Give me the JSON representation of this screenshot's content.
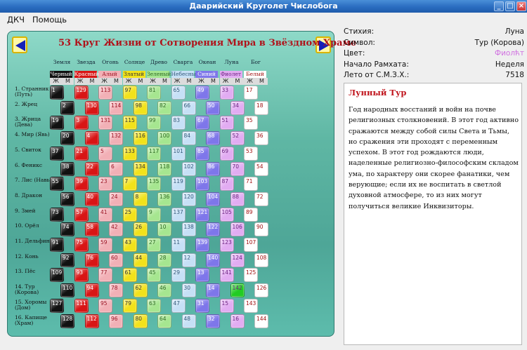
{
  "window": {
    "title": "Даарийский Круголет Числобога"
  },
  "menu": {
    "items": [
      "ДКЧ",
      "Помощь"
    ]
  },
  "board": {
    "header": "53  Круг Жизни от Сотворения Мира в Звёздном Храме",
    "elements": [
      "Земля",
      "Звезда",
      "Огонь",
      "Солнце",
      "Древо",
      "Сварга",
      "Океан",
      "Луна",
      "Бог"
    ],
    "colors": [
      {
        "name": "Черный",
        "hex": "#111111",
        "text": "#ffffff"
      },
      {
        "name": "Красный",
        "hex": "#d81515",
        "text": "#ffffff"
      },
      {
        "name": "Алый",
        "hex": "#f2b0b6",
        "text": "#9b1020"
      },
      {
        "name": "Златый",
        "hex": "#f2e21a",
        "text": "#333333"
      },
      {
        "name": "Зеленый",
        "hex": "#a6e690",
        "text": "#2d6b22"
      },
      {
        "name": "Небесный",
        "hex": "#c6e0f6",
        "text": "#345a7a"
      },
      {
        "name": "Синий",
        "hex": "#7e76ea",
        "text": "#ffffff"
      },
      {
        "name": "Фиолет",
        "hex": "#e2acf2",
        "text": "#6a1f7e"
      },
      {
        "name": "Белый",
        "hex": "#ffffff",
        "text": "#a01010"
      }
    ],
    "gm": [
      "Ж",
      "М"
    ],
    "rows": [
      "1. Странник (Путь)",
      "2. Жрец",
      "3. Жрица (Дева)",
      "4. Мир (Явь)",
      "5. Свиток",
      "6. Феникс",
      "7. Лис (Навь)",
      "8. Дракон",
      "9. Змей",
      "10. Орёл",
      "11. Дельфин",
      "12. Конь",
      "13. Пёс",
      "14. Тур (Корова)",
      "15. Хоромы (Дом)",
      "16. Капище (Храм)"
    ]
  },
  "numbers": [
    [
      1,
      129,
      113,
      97,
      81,
      65,
      49,
      33,
      17
    ],
    [
      2,
      130,
      114,
      98,
      82,
      66,
      50,
      34,
      18
    ],
    [
      19,
      3,
      131,
      115,
      99,
      83,
      67,
      51,
      35
    ],
    [
      20,
      4,
      132,
      116,
      100,
      84,
      68,
      52,
      36
    ],
    [
      37,
      21,
      5,
      133,
      117,
      101,
      85,
      69,
      53
    ],
    [
      38,
      22,
      6,
      134,
      118,
      102,
      86,
      70,
      54
    ],
    [
      55,
      39,
      23,
      7,
      135,
      119,
      103,
      87,
      71
    ],
    [
      56,
      40,
      24,
      8,
      136,
      120,
      104,
      88,
      72
    ],
    [
      73,
      57,
      41,
      25,
      9,
      137,
      121,
      105,
      89
    ],
    [
      74,
      58,
      42,
      26,
      10,
      138,
      122,
      106,
      90
    ],
    [
      91,
      75,
      59,
      43,
      27,
      11,
      139,
      123,
      107
    ],
    [
      92,
      76,
      60,
      44,
      28,
      12,
      140,
      124,
      108
    ],
    [
      109,
      93,
      77,
      61,
      45,
      29,
      13,
      141,
      125
    ],
    [
      110,
      94,
      78,
      62,
      46,
      30,
      14,
      142,
      126
    ],
    [
      127,
      111,
      95,
      79,
      63,
      47,
      31,
      15,
      143
    ],
    [
      128,
      112,
      96,
      80,
      64,
      48,
      32,
      16,
      144
    ]
  ],
  "highlight": {
    "number": 142,
    "color": "#22cc22"
  },
  "info": {
    "rows": [
      {
        "label": "Стихия:",
        "value": "Луна"
      },
      {
        "label": "Символ:",
        "value": "Тур (Корова)"
      },
      {
        "label": "Цвет:",
        "value": "Фиолћт"
      },
      {
        "label": "Начало Рамхата:",
        "value": "Неделя"
      },
      {
        "label": "Лето от С.М.З.Х.:",
        "value": "7518"
      }
    ],
    "color_value_hex": "#d070e0"
  },
  "description": {
    "title": "Лунный Тур",
    "text": "Год народных восстаний и войн на почве религиозных столкновений. В этот год активно сражаются между собой силы Света и Тьмы, но сражения эти проходят с переменным успехом. В этот год рождаются люди, наделенные религиозно-философским складом ума, по характеру они скорее фанатики, чем верующие; если их не воспитать в светлой духовной атмосфере, то из них могут получиться великие Инквизиторы."
  }
}
